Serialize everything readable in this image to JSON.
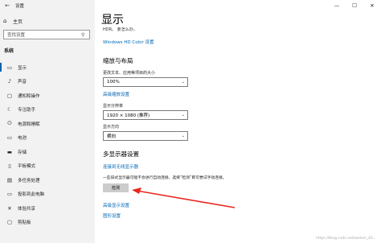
{
  "window": {
    "title": "设置",
    "back_icon": "back-arrow-icon",
    "minimize": "—",
    "maximize": "☐",
    "close": "✕"
  },
  "sidebar": {
    "home_label": "主页",
    "search_placeholder": "查找设置",
    "section_label": "系统",
    "items": [
      {
        "label": "显示",
        "icon": "monitor-icon",
        "glyph": "▭",
        "active": true
      },
      {
        "label": "声音",
        "icon": "speaker-icon",
        "glyph": "♪",
        "active": false
      },
      {
        "label": "通知和操作",
        "icon": "notification-icon",
        "glyph": "▢",
        "active": false
      },
      {
        "label": "专注助手",
        "icon": "moon-icon",
        "glyph": "☾",
        "active": false
      },
      {
        "label": "电源和睡眠",
        "icon": "power-icon",
        "glyph": "⏻",
        "active": false
      },
      {
        "label": "电池",
        "icon": "battery-icon",
        "glyph": "▭",
        "active": false
      },
      {
        "label": "存储",
        "icon": "storage-icon",
        "glyph": "▬",
        "active": false
      },
      {
        "label": "平板模式",
        "icon": "tablet-icon",
        "glyph": "▯",
        "active": false
      },
      {
        "label": "多任务处理",
        "icon": "multitask-icon",
        "glyph": "▤",
        "active": false
      },
      {
        "label": "投影到此电脑",
        "icon": "project-icon",
        "glyph": "▭",
        "active": false
      },
      {
        "label": "体验共享",
        "icon": "share-icon",
        "glyph": "✕",
        "active": false
      },
      {
        "label": "剪贴板",
        "icon": "clipboard-icon",
        "glyph": "▢",
        "active": false
      }
    ]
  },
  "main": {
    "page_title": "显示",
    "desc_cut": "HDR。 要怎么办。",
    "hd_color_link": "Windows HD Color 设置",
    "scale_header": "缩放与布局",
    "scale_label": "更改文本、应用等项目的大小",
    "scale_value": "100%",
    "advanced_scale_link": "高级缩放设置",
    "resolution_label": "显示分辨率",
    "resolution_value": "1920 × 1080 (推荐)",
    "orientation_label": "显示方向",
    "orientation_value": "横向",
    "multi_header": "多显示器设置",
    "wireless_link": "连接到无线显示器",
    "detect_desc": "一些旧式显示器可能不会进行自动连接。选择“检测”即可尝试手动连接。",
    "detect_button": "检测",
    "advanced_display_link": "高级显示设置",
    "graphics_link": "图形设置"
  },
  "annotation": {
    "arrow_color": "#e8281e"
  },
  "watermark": "https://blog.csdn.net/weixin_43..."
}
